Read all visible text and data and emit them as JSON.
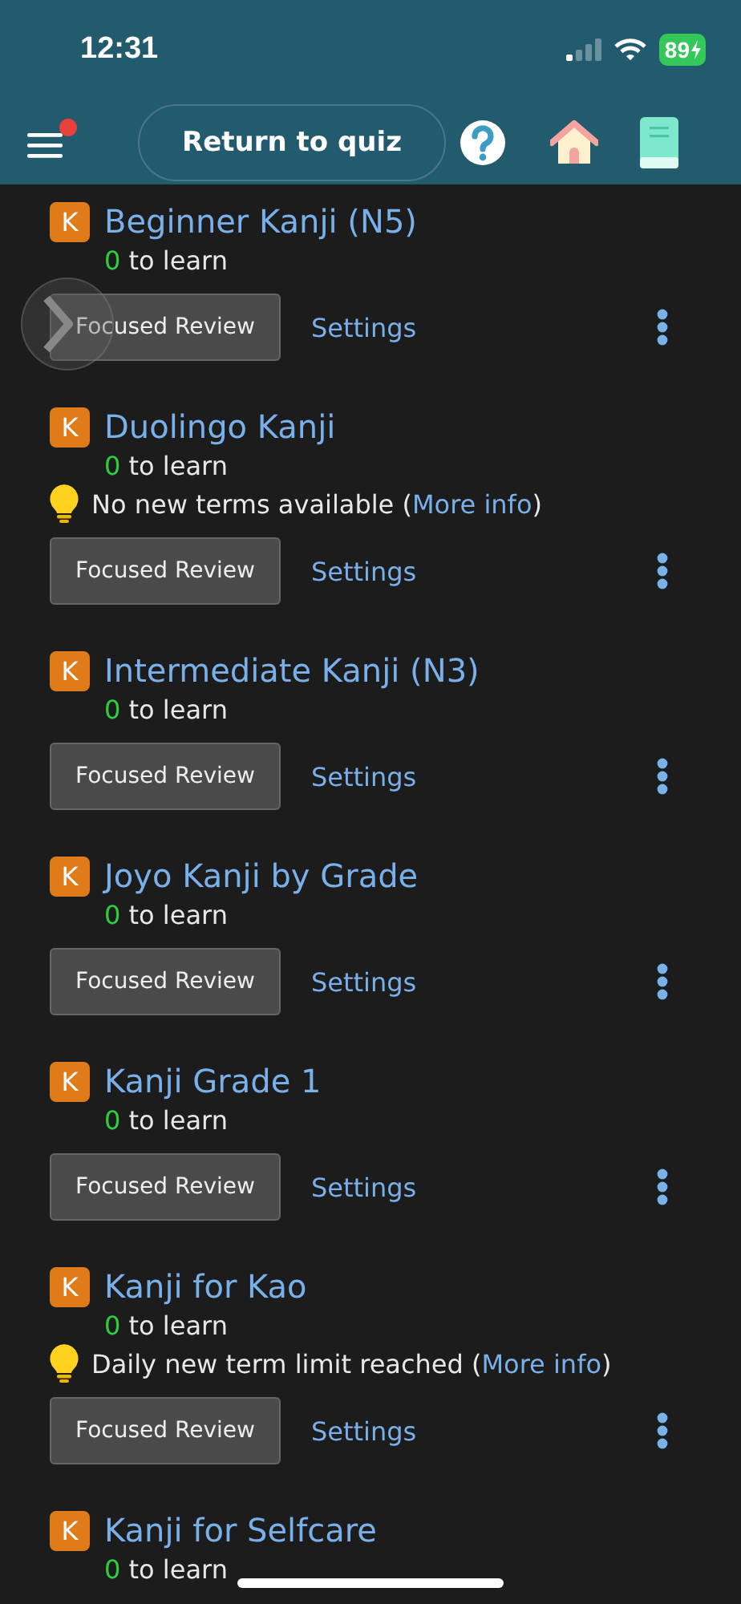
{
  "status_bar": {
    "time": "12:31",
    "battery": "89"
  },
  "header": {
    "menu_notification": true,
    "return_button": "Return to quiz"
  },
  "decks": [
    {
      "badge": "K",
      "title": "Beginner Kanji (N5)",
      "count": "0",
      "count_label": "to learn",
      "review_button": "Focused Review",
      "settings_link": "Settings"
    },
    {
      "badge": "K",
      "title": "Duolingo Kanji",
      "count": "0",
      "count_label": "to learn",
      "tip": {
        "before": "No new terms available (",
        "link": "More info",
        "after": ")"
      },
      "review_button": "Focused Review",
      "settings_link": "Settings"
    },
    {
      "badge": "K",
      "title": "Intermediate Kanji (N3)",
      "count": "0",
      "count_label": "to learn",
      "review_button": "Focused Review",
      "settings_link": "Settings"
    },
    {
      "badge": "K",
      "title": "Joyo Kanji by Grade",
      "count": "0",
      "count_label": "to learn",
      "review_button": "Focused Review",
      "settings_link": "Settings"
    },
    {
      "badge": "K",
      "title": "Kanji Grade 1",
      "count": "0",
      "count_label": "to learn",
      "review_button": "Focused Review",
      "settings_link": "Settings"
    },
    {
      "badge": "K",
      "title": "Kanji for Kao",
      "count": "0",
      "count_label": "to learn",
      "tip": {
        "before": "Daily new term limit reached (",
        "link": "More info",
        "after": ")"
      },
      "review_button": "Focused Review",
      "settings_link": "Settings"
    },
    {
      "badge": "K",
      "title": "Kanji for Selfcare",
      "count": "0",
      "count_label": "to learn"
    }
  ]
}
